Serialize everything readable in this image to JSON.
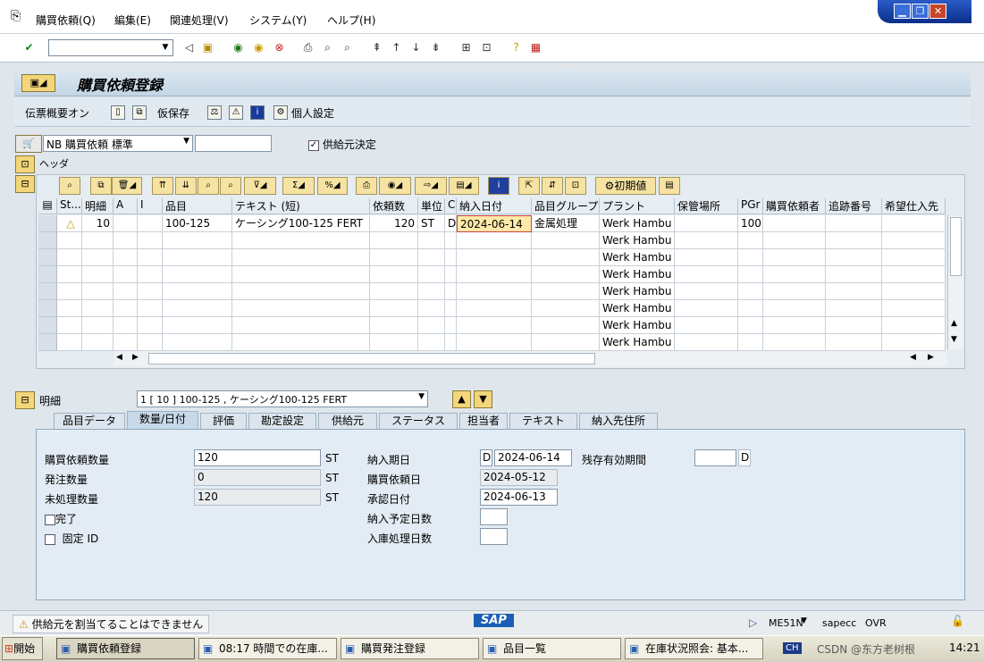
{
  "menu": {
    "items": [
      "購買依頼(Q)",
      "編集(E)",
      "関連処理(V)",
      "システム(Y)",
      "ヘルプ(H)"
    ]
  },
  "window_controls": {
    "min": "▁",
    "restore": "❐",
    "close": "✕"
  },
  "app": {
    "title": "購買依頼登録",
    "buttons": {
      "doc_overview": "伝票概要オン",
      "hold": "仮保存",
      "personal_settings": "個人設定"
    }
  },
  "header": {
    "doc_type": "NB 購買依頼 標準",
    "doc_number": "",
    "source_determination_label": "供給元決定",
    "source_determination_checked": true,
    "header_label": "ヘッダ"
  },
  "grid": {
    "toolbar_button_initial": "初期値",
    "columns": [
      "St...",
      "明細",
      "A",
      "I",
      "品目",
      "テキスト (短)",
      "依頼数",
      "単位",
      "C",
      "納入日付",
      "品目グループ",
      "プラント",
      "保管場所",
      "PGr",
      "購買依頼者",
      "追跡番号",
      "希望仕入先"
    ],
    "rows": [
      {
        "status": "△",
        "item": "10",
        "a": "",
        "i": "",
        "material": "100-125",
        "text": "ケーシング100-125 FERT",
        "qty": "120",
        "unit": "ST",
        "c": "D",
        "date": "2024-06-14",
        "group": "金属処理",
        "plant": "Werk Hambu",
        "sloc": "",
        "pgr": "100"
      },
      {
        "plant": "Werk Hambu"
      },
      {
        "plant": "Werk Hambu"
      },
      {
        "plant": "Werk Hambu"
      },
      {
        "plant": "Werk Hambu"
      },
      {
        "plant": "Werk Hambu"
      },
      {
        "plant": "Werk Hambu"
      },
      {
        "plant": "Werk Hambu"
      }
    ]
  },
  "detail": {
    "label": "明細",
    "selected_item": "1 [ 10 ] 100-125 , ケーシング100-125 FERT",
    "tabs": [
      "品目データ",
      "数量/日付",
      "評価",
      "勘定設定",
      "供給元",
      "ステータス",
      "担当者",
      "テキスト",
      "納入先住所"
    ],
    "active_tab": "数量/日付",
    "fields": {
      "pr_qty_label": "購買依頼数量",
      "pr_qty": "120",
      "pr_qty_unit": "ST",
      "order_qty_label": "発注数量",
      "order_qty": "0",
      "order_qty_unit": "ST",
      "open_qty_label": "未処理数量",
      "open_qty": "120",
      "open_qty_unit": "ST",
      "complete_label": "完了",
      "fixed_id_label": "固定 ID",
      "delivery_date_label": "納入期日",
      "delivery_date_cat": "D",
      "delivery_date": "2024-06-14",
      "request_date_label": "購買依頼日",
      "request_date": "2024-05-12",
      "release_date_label": "承認日付",
      "release_date": "2024-06-13",
      "planned_days_label": "納入予定日数",
      "planned_days": "",
      "gr_days_label": "入庫処理日数",
      "gr_days": "",
      "remaining_shelf_label": "残存有効期間",
      "remaining_shelf": "",
      "remaining_shelf_unit": "D"
    }
  },
  "status": {
    "message": "供給元を割当てることはできません",
    "logo": "SAP",
    "transaction": "ME51N",
    "system": "sapecc",
    "mode": "OVR"
  },
  "taskbar": {
    "start": "開始",
    "tasks": [
      "購買依頼登録",
      "08:17 時間での在庫...",
      "購買発注登録",
      "品目一覧",
      "在庫状況照会: 基本..."
    ],
    "ime": "CH",
    "watermark": "CSDN @东方老树根",
    "clock": "14:21"
  },
  "colors": {
    "accent": "#f3d67a",
    "title_bg": "#c3d5e4",
    "warning": "#e8c400"
  }
}
